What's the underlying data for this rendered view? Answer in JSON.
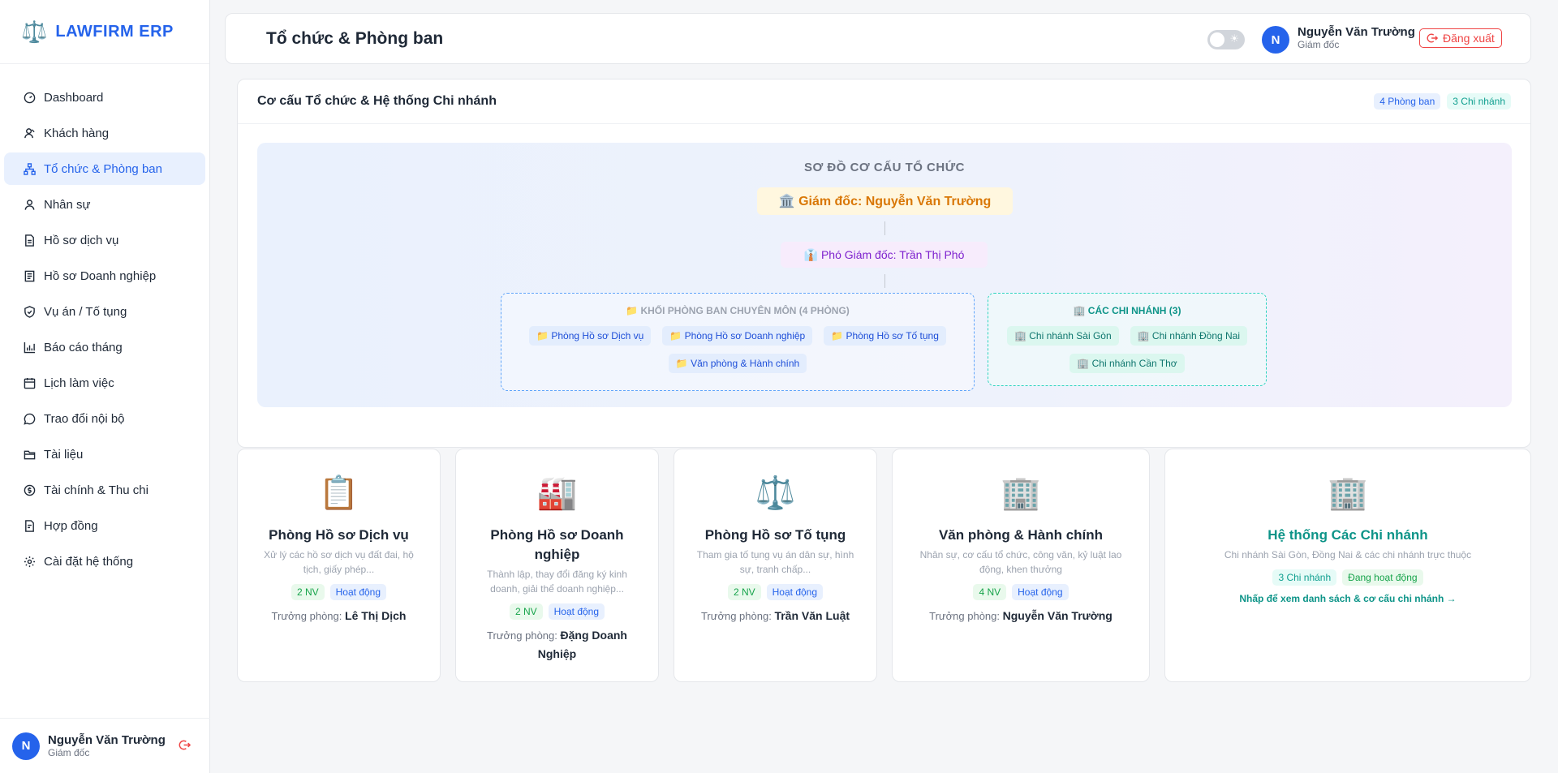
{
  "sidebar": {
    "logo_icon": "⚖️",
    "logo_text": "LAWFIRM ERP",
    "items": [
      {
        "label": "Dashboard",
        "icon": "dashboard-icon"
      },
      {
        "label": "Khách hàng",
        "icon": "customers-icon"
      },
      {
        "label": "Tổ chức & Phòng ban",
        "icon": "org-chart-icon",
        "active": true
      },
      {
        "label": "Nhân sự",
        "icon": "user-icon"
      },
      {
        "label": "Hồ sơ dịch vụ",
        "icon": "file-icon"
      },
      {
        "label": "Hồ sơ Doanh nghiệp",
        "icon": "document-icon"
      },
      {
        "label": "Vụ án / Tố tụng",
        "icon": "shield-icon"
      },
      {
        "label": "Báo cáo tháng",
        "icon": "bar-chart-icon"
      },
      {
        "label": "Lịch làm việc",
        "icon": "calendar-icon"
      },
      {
        "label": "Trao đổi nội bộ",
        "icon": "chat-icon"
      },
      {
        "label": "Tài liệu",
        "icon": "folder-icon"
      },
      {
        "label": "Tài chính & Thu chi",
        "icon": "dollar-icon"
      },
      {
        "label": "Hợp đồng",
        "icon": "contract-icon"
      },
      {
        "label": "Cài đặt hệ thống",
        "icon": "gear-icon"
      }
    ],
    "user": {
      "initial": "N",
      "name": "Nguyễn Văn Trường",
      "role": "Giám đốc"
    }
  },
  "header": {
    "title": "Tổ chức & Phòng ban",
    "theme_toggle_icon": "☀",
    "user": {
      "initial": "N",
      "name": "Nguyễn Văn Trường",
      "role": "Giám đốc"
    },
    "logout_label": "Đăng xuất"
  },
  "org": {
    "panel_title": "Cơ cấu Tổ chức & Hệ thống Chi nhánh",
    "dept_count_badge": "4 Phòng ban",
    "branch_count_badge": "3 Chi nhánh",
    "chart_title": "SƠ ĐỒ CƠ CẤU TỔ CHỨC",
    "director": "🏛️ Giám đốc: Nguyễn Văn Trường",
    "deputy": "👔 Phó Giám đốc: Trần Thị Phó",
    "dept_block_title": "📁 KHỐI PHÒNG BAN CHUYÊN MÔN (4 PHÒNG)",
    "departments": [
      "📁 Phòng Hồ sơ Dịch vụ",
      "📁 Phòng Hồ sơ Doanh nghiệp",
      "📁 Phòng Hồ sơ Tố tụng",
      "📁 Văn phòng & Hành chính"
    ],
    "branch_block_title": "🏢 CÁC CHI NHÁNH (3)",
    "branches": [
      "🏢 Chi nhánh Sài Gòn",
      "🏢 Chi nhánh Đồng Nai",
      "🏢 Chi nhánh Cần Thơ"
    ]
  },
  "cards": [
    {
      "icon": "📋",
      "title": "Phòng Hồ sơ Dịch vụ",
      "desc": "Xử lý các hồ sơ dịch vụ đất đai, hộ tịch, giấy phép...",
      "staff": "2 NV",
      "status": "Hoạt động",
      "head_label": "Trưởng phòng:",
      "head": "Lê Thị Dịch"
    },
    {
      "icon": "🏭",
      "title": "Phòng Hồ sơ Doanh nghiệp",
      "desc": "Thành lập, thay đổi đăng ký kinh doanh, giải thể doanh nghiệp...",
      "staff": "2 NV",
      "status": "Hoạt động",
      "head_label": "Trưởng phòng:",
      "head": "Đặng Doanh Nghiệp"
    },
    {
      "icon": "⚖️",
      "title": "Phòng Hồ sơ Tố tụng",
      "desc": "Tham gia tố tụng vụ án dân sự, hình sự, tranh chấp...",
      "staff": "2 NV",
      "status": "Hoạt động",
      "head_label": "Trưởng phòng:",
      "head": "Trần Văn Luật"
    },
    {
      "icon": "🏢",
      "title": "Văn phòng & Hành chính",
      "desc": "Nhân sự, cơ cấu tổ chức, công văn, kỷ luật lao động, khen thưởng",
      "staff": "4 NV",
      "status": "Hoạt động",
      "head_label": "Trưởng phòng:",
      "head": "Nguyễn Văn Trường"
    }
  ],
  "branch_card": {
    "icon": "🏢",
    "title": "Hệ thống Các Chi nhánh",
    "desc": "Chi nhánh Sài Gòn, Đồng Nai & các chi nhánh trực thuộc",
    "count": "3 Chi nhánh",
    "status": "Đang hoạt động",
    "link": "Nhấp để xem danh sách & cơ cấu chi nhánh →"
  },
  "colors": {
    "accent": "#2563eb",
    "teal": "#0d9488",
    "danger": "#ef4444",
    "director": "#d97706",
    "deputy": "#7e22ce"
  }
}
